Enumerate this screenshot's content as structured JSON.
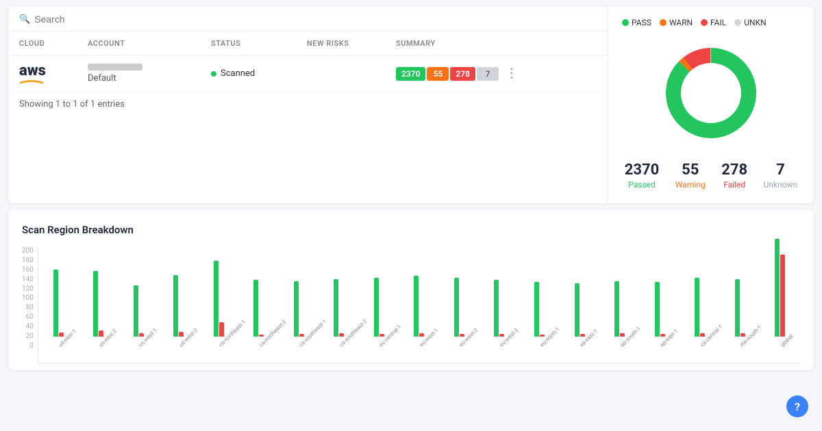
{
  "search": {
    "placeholder": "Search"
  },
  "legend": {
    "items": [
      {
        "label": "PASS",
        "color": "#22c55e"
      },
      {
        "label": "WARN",
        "color": "#f97316"
      },
      {
        "label": "FAIL",
        "color": "#ef4444"
      },
      {
        "label": "UNKN",
        "color": "#d1d5db"
      }
    ]
  },
  "table": {
    "headers": [
      "CLOUD",
      "ACCOUNT",
      "STATUS",
      "NEW RISKS",
      "SUMMARY"
    ],
    "row": {
      "cloud": "aws",
      "account_name": "Default",
      "status": "Scanned",
      "summary": {
        "pass": "2370",
        "warn": "55",
        "fail": "278",
        "unkn": "7"
      }
    },
    "entries_text": "Showing 1 to 1 of 1 entries"
  },
  "donut": {
    "stats": {
      "passed": {
        "value": "2370",
        "label": "Passed"
      },
      "warning": {
        "value": "55",
        "label": "Warning"
      },
      "failed": {
        "value": "278",
        "label": "Failed"
      },
      "unknown": {
        "value": "7",
        "label": "Unknown"
      }
    },
    "segments": {
      "pass_pct": 86.6,
      "warn_pct": 2.0,
      "fail_pct": 10.2,
      "unkn_pct": 0.3
    }
  },
  "chart": {
    "title": "Scan Region Breakdown",
    "y_labels": [
      "200",
      "180",
      "160",
      "140",
      "120",
      "100",
      "80",
      "60",
      "40",
      "20",
      "0"
    ],
    "max": 200,
    "regions": [
      {
        "label": "us-east-1",
        "green": 130,
        "red": 8
      },
      {
        "label": "us-east-2",
        "green": 128,
        "red": 12
      },
      {
        "label": "us-west-1",
        "green": 100,
        "red": 6
      },
      {
        "label": "us-west-2",
        "green": 120,
        "red": 9
      },
      {
        "label": "ca-northeast-1",
        "green": 148,
        "red": 28
      },
      {
        "label": "ca-northeast-2",
        "green": 110,
        "red": 4
      },
      {
        "label": "ca-southeast-1",
        "green": 108,
        "red": 5
      },
      {
        "label": "ca-southeast-2",
        "green": 112,
        "red": 6
      },
      {
        "label": "eu-central-1",
        "green": 115,
        "red": 5
      },
      {
        "label": "eu-west-1",
        "green": 118,
        "red": 6
      },
      {
        "label": "eu-west-2",
        "green": 115,
        "red": 5
      },
      {
        "label": "eu-west-3",
        "green": 110,
        "red": 5
      },
      {
        "label": "eu-north-1",
        "green": 106,
        "red": 4
      },
      {
        "label": "sa-east-1",
        "green": 104,
        "red": 5
      },
      {
        "label": "ap-south-1",
        "green": 108,
        "red": 6
      },
      {
        "label": "ap-east-1",
        "green": 106,
        "red": 5
      },
      {
        "label": "ca-central-1",
        "green": 115,
        "red": 7
      },
      {
        "label": "me-south-1",
        "green": 112,
        "red": 6
      },
      {
        "label": "global",
        "green": 190,
        "red": 160
      }
    ]
  },
  "help_button": {
    "label": "?"
  }
}
